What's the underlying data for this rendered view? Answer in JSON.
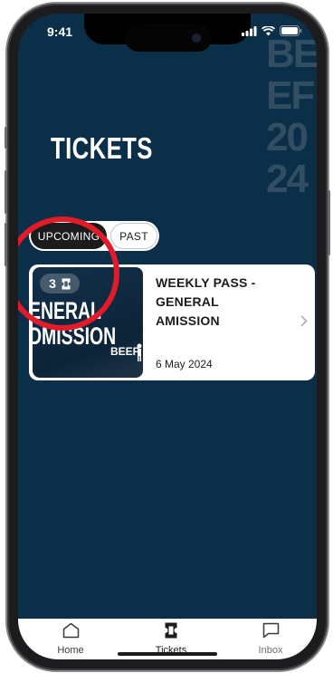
{
  "status_bar": {
    "time": "9:41"
  },
  "background_text": [
    "BEEF",
    "EF",
    "20",
    "24"
  ],
  "page": {
    "title": "TICKETS"
  },
  "tabs": {
    "upcoming": "UPCOMING",
    "past": "PAST"
  },
  "ticket_card": {
    "count": "3",
    "thumbnail_lines": [
      "ENERAL",
      "DMISSION"
    ],
    "thumbnail_logo": "BEEF",
    "title": "WEEKLY PASS - GENERAL AMISSION",
    "date": "6 May 2024"
  },
  "tab_bar": {
    "items": [
      {
        "label": "Home",
        "icon": "home-icon"
      },
      {
        "label": "Tickets",
        "icon": "ticket-icon"
      },
      {
        "label": "Inbox",
        "icon": "inbox-icon"
      }
    ],
    "active_index": 1
  },
  "colors": {
    "screen_bg": "#0b2f48",
    "highlight_ring": "#e21b2a",
    "card_bg": "#ffffff",
    "active_tab": "#1c1c1e"
  }
}
